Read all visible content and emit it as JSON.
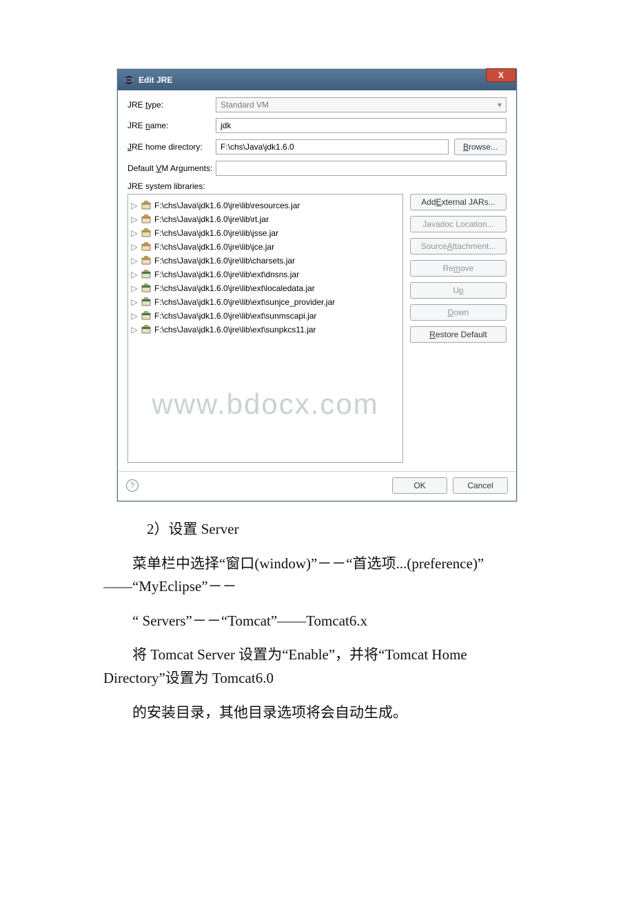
{
  "dialog": {
    "title": "Edit JRE",
    "close_label": "X",
    "labels": {
      "jre_type": "JRE type:",
      "jre_type_ul": "t",
      "jre_name": "JRE name:",
      "jre_name_ul": "n",
      "jre_home": "JRE home directory:",
      "jre_home_ul": "J",
      "vm_args": "Default VM Arguments:",
      "vm_args_ul": "V",
      "sys_libs": "JRE system libraries:"
    },
    "fields": {
      "jre_type": "Standard VM",
      "jre_name": "jdk",
      "jre_home": "F:\\chs\\Java\\jdk1.6.0",
      "vm_args": ""
    },
    "browse_btn": "Browse...",
    "browse_ul": "B",
    "libs": [
      {
        "icon": "system",
        "path": "F:\\chs\\Java\\jdk1.6.0\\jre\\lib\\resources.jar"
      },
      {
        "icon": "system",
        "path": "F:\\chs\\Java\\jdk1.6.0\\jre\\lib\\rt.jar"
      },
      {
        "icon": "system",
        "path": "F:\\chs\\Java\\jdk1.6.0\\jre\\lib\\jsse.jar"
      },
      {
        "icon": "system",
        "path": "F:\\chs\\Java\\jdk1.6.0\\jre\\lib\\jce.jar"
      },
      {
        "icon": "system",
        "path": "F:\\chs\\Java\\jdk1.6.0\\jre\\lib\\charsets.jar"
      },
      {
        "icon": "jar",
        "path": "F:\\chs\\Java\\jdk1.6.0\\jre\\lib\\ext\\dnsns.jar"
      },
      {
        "icon": "jar",
        "path": "F:\\chs\\Java\\jdk1.6.0\\jre\\lib\\ext\\localedata.jar"
      },
      {
        "icon": "jar",
        "path": "F:\\chs\\Java\\jdk1.6.0\\jre\\lib\\ext\\sunjce_provider.jar"
      },
      {
        "icon": "jar",
        "path": "F:\\chs\\Java\\jdk1.6.0\\jre\\lib\\ext\\sunmscapi.jar"
      },
      {
        "icon": "jar",
        "path": "F:\\chs\\Java\\jdk1.6.0\\jre\\lib\\ext\\sunpkcs11.jar"
      }
    ],
    "side_buttons": {
      "add_ext": {
        "text": "Add External JARs...",
        "ul": "E",
        "enabled": true
      },
      "javadoc": {
        "text": "Javadoc Location...",
        "ul": "",
        "enabled": false
      },
      "src_att": {
        "text": "Source Attachment...",
        "ul": "A",
        "enabled": false
      },
      "remove": {
        "text": "Remove",
        "ul": "m",
        "enabled": false
      },
      "up": {
        "text": "Up",
        "ul": "p",
        "enabled": false
      },
      "down": {
        "text": "Down",
        "ul": "D",
        "enabled": false
      },
      "restore": {
        "text": "Restore Default",
        "ul": "R",
        "enabled": true
      }
    },
    "footer": {
      "ok": "OK",
      "cancel": "Cancel"
    },
    "watermark": "www.bdocx.com"
  },
  "doc": {
    "p1": "2）设置 Server",
    "p2": "菜单栏中选择“窗口(window)”－－“首选项...(preference)” ——“MyEclipse”－－",
    "p3": "“ Servers”－－“Tomcat”——Tomcat6.x",
    "p4": "将 Tomcat Server 设置为“Enable”，并将“Tomcat Home Directory”设置为 Tomcat6.0",
    "p5": "的安装目录，其他目录选项将会自动生成。"
  }
}
